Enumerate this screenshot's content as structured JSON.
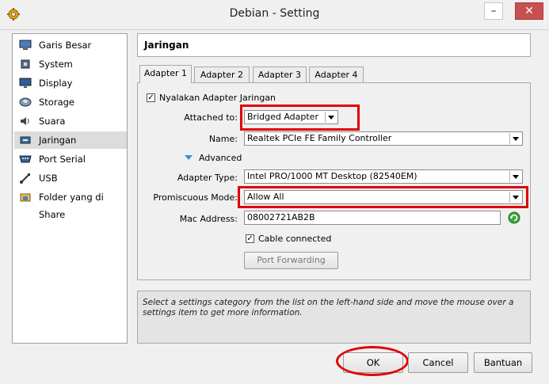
{
  "window": {
    "title": "Debian - Setting",
    "min": "–",
    "max": "□",
    "close": "✕"
  },
  "sidebar": {
    "items": [
      {
        "label": "Garis Besar",
        "icon": "monitor-icon"
      },
      {
        "label": "System",
        "icon": "chip-icon"
      },
      {
        "label": "Display",
        "icon": "display-icon"
      },
      {
        "label": "Storage",
        "icon": "disk-icon"
      },
      {
        "label": "Suara",
        "icon": "speaker-icon"
      },
      {
        "label": "Jaringan",
        "icon": "network-icon",
        "selected": true
      },
      {
        "label": "Port Serial",
        "icon": "serial-port-icon"
      },
      {
        "label": "USB",
        "icon": "usb-icon"
      },
      {
        "label": "Folder yang di Share",
        "icon": "shared-folder-icon"
      }
    ]
  },
  "section": {
    "title": "Jaringan"
  },
  "tabs": [
    "Adapter 1",
    "Adapter 2",
    "Adapter 3",
    "Adapter 4"
  ],
  "adapter": {
    "enable_label": "Nyalakan Adapter Jaringan",
    "attached_label": "Attached to:",
    "attached_value": "Bridged Adapter",
    "name_label": "Name:",
    "name_value": "Realtek PCIe FE Family Controller",
    "advanced_label": "Advanced",
    "type_label": "Adapter Type:",
    "type_value": "Intel PRO/1000 MT Desktop (82540EM)",
    "promisc_label": "Promiscuous Mode:",
    "promisc_value": "Allow All",
    "mac_label": "Mac Address:",
    "mac_value": "08002721AB2B",
    "cable_label": "Cable connected",
    "port_forwarding_label": "Port Forwarding"
  },
  "help": {
    "text": "Select a settings category from the list on the left-hand side and move the mouse over a settings item to get more information."
  },
  "buttons": {
    "ok": "OK",
    "cancel": "Cancel",
    "help": "Bantuan"
  },
  "colors": {
    "highlight": "#e10000",
    "refresh": "#3aa83a"
  }
}
